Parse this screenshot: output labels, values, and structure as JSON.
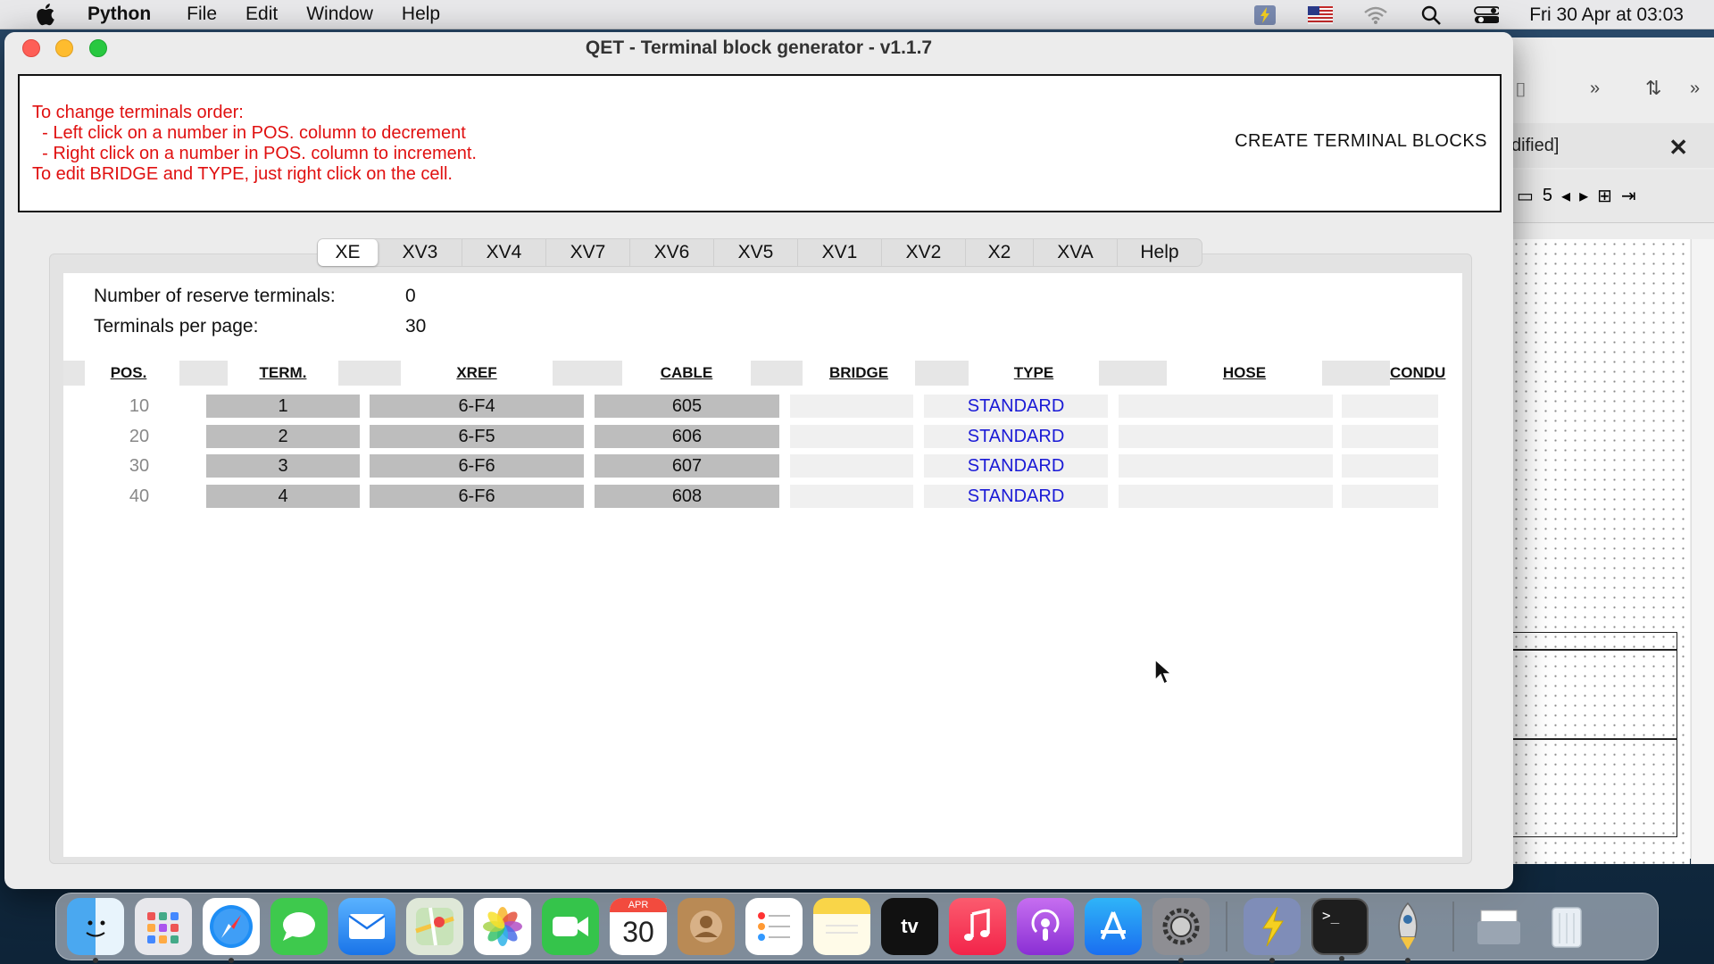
{
  "menubar": {
    "app_name": "Python",
    "items": [
      "File",
      "Edit",
      "Window",
      "Help"
    ],
    "clock": "Fri 30 Apr at 03:03"
  },
  "window": {
    "title": "QET - Terminal block generator - v1.1.7"
  },
  "info": {
    "lines": [
      "To change terminals order:",
      "  - Left click on a number in POS. column to decrement",
      "  - Right click on a number in POS. column to increment.",
      "To edit BRIDGE and TYPE, just right click on the cell."
    ],
    "create_button": "CREATE TERMINAL BLOCKS"
  },
  "tabs": [
    "XE",
    "XV3",
    "XV4",
    "XV7",
    "XV6",
    "XV5",
    "XV1",
    "XV2",
    "X2",
    "XVA",
    "Help"
  ],
  "active_tab": "XE",
  "settings": {
    "reserve_label": "Number of reserve terminals:",
    "reserve_value": "0",
    "per_page_label": "Terminals per page:",
    "per_page_value": "30"
  },
  "table": {
    "headers": [
      "POS.",
      "TERM.",
      "XREF",
      "CABLE",
      "BRIDGE",
      "TYPE",
      "HOSE",
      "CONDU"
    ],
    "rows": [
      {
        "pos": "10",
        "term": "1",
        "xref": "6-F4",
        "cable": "605",
        "bridge": "",
        "type": "STANDARD",
        "hose": "",
        "condu": ""
      },
      {
        "pos": "20",
        "term": "2",
        "xref": "6-F5",
        "cable": "606",
        "bridge": "",
        "type": "STANDARD",
        "hose": "",
        "condu": ""
      },
      {
        "pos": "30",
        "term": "3",
        "xref": "6-F6",
        "cable": "607",
        "bridge": "",
        "type": "STANDARD",
        "hose": "",
        "condu": ""
      },
      {
        "pos": "40",
        "term": "4",
        "xref": "6-F6",
        "cable": "608",
        "bridge": "",
        "type": "STANDARD",
        "hose": "",
        "condu": ""
      }
    ]
  },
  "background_window": {
    "tab_title": "dified]",
    "page_number": "5"
  },
  "dock": {
    "calendar_month": "APR",
    "calendar_day": "30",
    "apps": [
      "finder",
      "launchpad",
      "safari",
      "messages",
      "mail",
      "maps",
      "photos",
      "facetime",
      "calendar",
      "contacts",
      "reminders",
      "notes",
      "apple-tv",
      "music",
      "podcasts",
      "app-store",
      "system-preferences",
      "qelectrotech",
      "terminal",
      "python-launcher",
      "documents-folder",
      "trash"
    ]
  },
  "colors": {
    "info_text": "#e01010",
    "type_text": "#1a1ad6",
    "grey_cell": "#bdbdbd"
  }
}
